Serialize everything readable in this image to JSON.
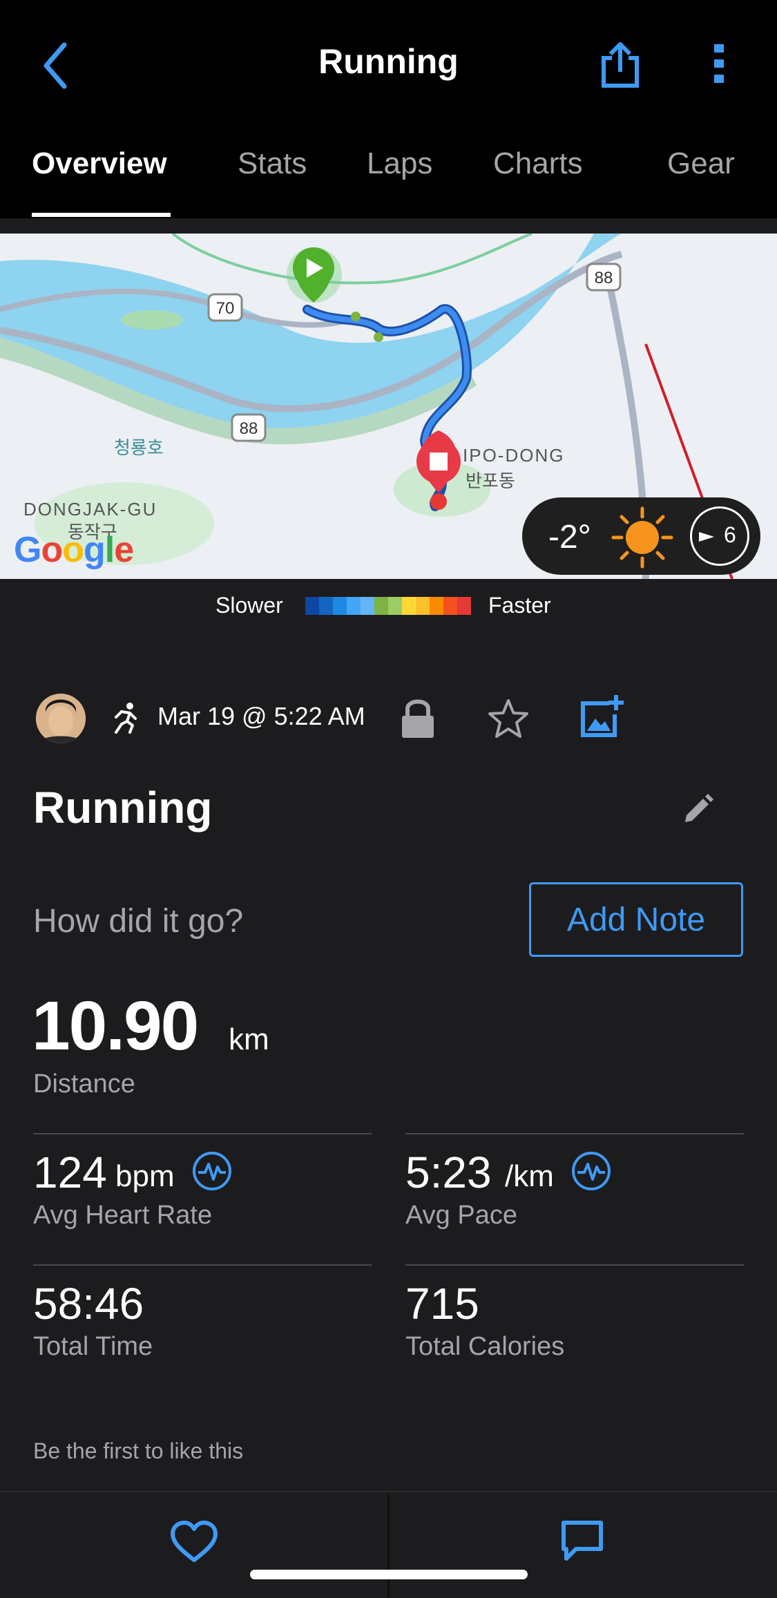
{
  "header": {
    "title": "Running"
  },
  "tabs": [
    {
      "label": "Overview",
      "active": true
    },
    {
      "label": "Stats"
    },
    {
      "label": "Laps"
    },
    {
      "label": "Charts"
    },
    {
      "label": "Gear"
    }
  ],
  "map": {
    "labels": {
      "district": "DONGJAK-GU",
      "district_kr": "동작구",
      "neighborhood": "IPO-DONG",
      "neighborhood_kr": "반포동",
      "landmark": "청룡호"
    },
    "road_shields": [
      "70",
      "88",
      "88"
    ],
    "weather": {
      "temperature": "-2°",
      "wind": "6",
      "icon": "sun-icon"
    }
  },
  "legend": {
    "slower": "Slower",
    "faster": "Faster",
    "colors": [
      "#0d47a1",
      "#1565c0",
      "#1e88e5",
      "#42a5f5",
      "#64b5f6",
      "#7cb342",
      "#9ccc65",
      "#fdd835",
      "#fbc02d",
      "#fb8c00",
      "#f4511e",
      "#e53935"
    ]
  },
  "activity": {
    "date": "Mar 19 @ 5:22 AM",
    "name": "Running",
    "prompt": "How did it go?",
    "add_note": "Add Note",
    "distance": {
      "value": "10.90",
      "unit": "km",
      "label": "Distance"
    },
    "heart_rate": {
      "value": "124",
      "unit": "bpm",
      "label": "Avg Heart Rate"
    },
    "pace": {
      "value": "5:23",
      "unit": "/km",
      "label": "Avg Pace"
    },
    "total_time": {
      "value": "58:46",
      "label": "Total Time"
    },
    "calories": {
      "value": "715",
      "label": "Total Calories"
    },
    "likes_text": "Be the first to like this"
  },
  "colors": {
    "accent": "#3f9af5",
    "background": "#1c1c1e",
    "topbar": "#000000"
  }
}
